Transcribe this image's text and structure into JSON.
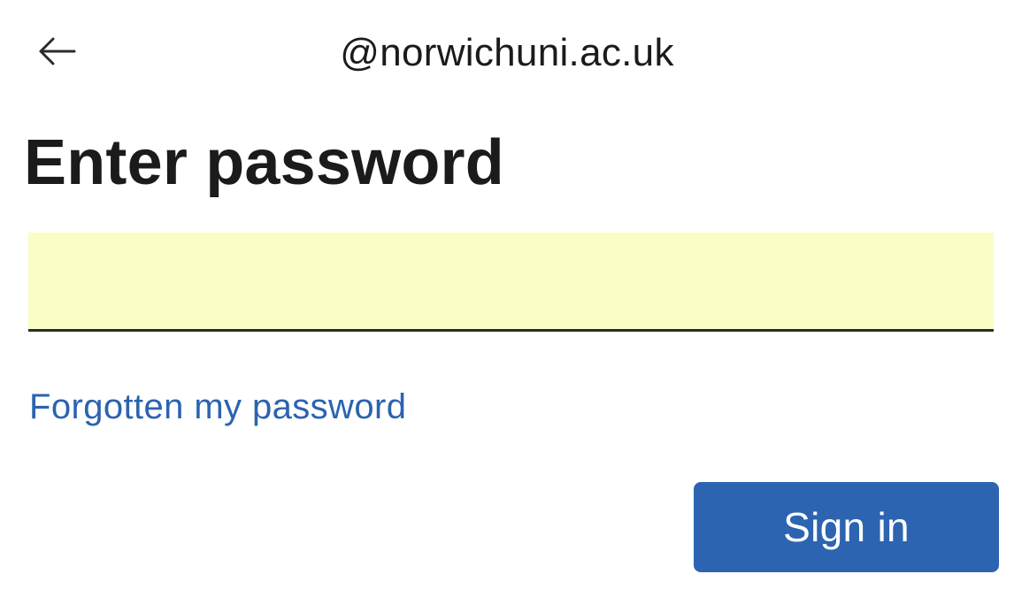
{
  "header": {
    "back_icon": "arrow-left-icon",
    "identity": "@norwichuni.ac.uk"
  },
  "main": {
    "title": "Enter password",
    "password": {
      "value": "",
      "placeholder": "",
      "background_color": "#fafec4"
    },
    "forgot_link": "Forgotten my password",
    "signin_label": "Sign in"
  },
  "colors": {
    "accent": "#2c64b2",
    "link": "#2b63b0",
    "text": "#1b1b1b"
  }
}
